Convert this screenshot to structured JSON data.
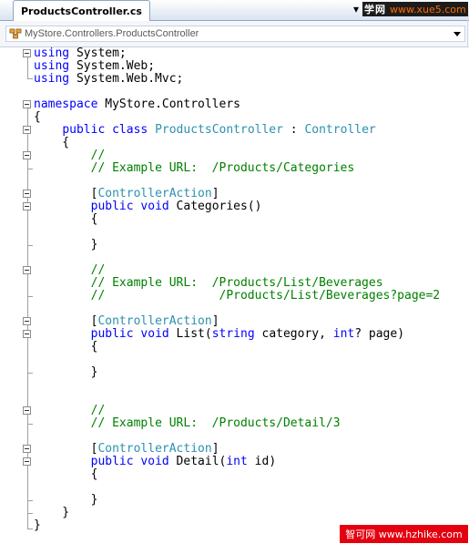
{
  "tab": {
    "title": "ProductsController.cs",
    "close_glyph": "▾"
  },
  "watermark_top": {
    "cn": "学网",
    "url": "www.xue5.com"
  },
  "navbar": {
    "class_path": "MyStore.Controllers.ProductsController"
  },
  "code_lines": [
    [
      {
        "t": "using",
        "c": "kw"
      },
      {
        "t": " System;"
      }
    ],
    [
      {
        "t": "using",
        "c": "kw"
      },
      {
        "t": " System.Web;"
      }
    ],
    [
      {
        "t": "using",
        "c": "kw"
      },
      {
        "t": " System.Web.Mvc;"
      }
    ],
    [],
    [
      {
        "t": "namespace",
        "c": "kw"
      },
      {
        "t": " MyStore.Controllers"
      }
    ],
    [
      {
        "t": "{"
      }
    ],
    [
      {
        "t": "    "
      },
      {
        "t": "public",
        "c": "kw"
      },
      {
        "t": " "
      },
      {
        "t": "class",
        "c": "kw"
      },
      {
        "t": " "
      },
      {
        "t": "ProductsController",
        "c": "ty"
      },
      {
        "t": " : "
      },
      {
        "t": "Controller",
        "c": "ty"
      }
    ],
    [
      {
        "t": "    {"
      }
    ],
    [
      {
        "t": "        "
      },
      {
        "t": "//",
        "c": "cm"
      }
    ],
    [
      {
        "t": "        "
      },
      {
        "t": "// Example URL:  /Products/Categories",
        "c": "cm"
      }
    ],
    [],
    [
      {
        "t": "        ["
      },
      {
        "t": "ControllerAction",
        "c": "ty"
      },
      {
        "t": "]"
      }
    ],
    [
      {
        "t": "        "
      },
      {
        "t": "public",
        "c": "kw"
      },
      {
        "t": " "
      },
      {
        "t": "void",
        "c": "kw"
      },
      {
        "t": " Categories()"
      }
    ],
    [
      {
        "t": "        {"
      }
    ],
    [],
    [
      {
        "t": "        }"
      }
    ],
    [],
    [
      {
        "t": "        "
      },
      {
        "t": "//",
        "c": "cm"
      }
    ],
    [
      {
        "t": "        "
      },
      {
        "t": "// Example URL:  /Products/List/Beverages",
        "c": "cm"
      }
    ],
    [
      {
        "t": "        "
      },
      {
        "t": "//                /Products/List/Beverages?page=2",
        "c": "cm"
      }
    ],
    [],
    [
      {
        "t": "        ["
      },
      {
        "t": "ControllerAction",
        "c": "ty"
      },
      {
        "t": "]"
      }
    ],
    [
      {
        "t": "        "
      },
      {
        "t": "public",
        "c": "kw"
      },
      {
        "t": " "
      },
      {
        "t": "void",
        "c": "kw"
      },
      {
        "t": " List("
      },
      {
        "t": "string",
        "c": "kw"
      },
      {
        "t": " category, "
      },
      {
        "t": "int",
        "c": "kw"
      },
      {
        "t": "? page)"
      }
    ],
    [
      {
        "t": "        {"
      }
    ],
    [],
    [
      {
        "t": "        }"
      }
    ],
    [],
    [],
    [
      {
        "t": "        "
      },
      {
        "t": "//",
        "c": "cm"
      }
    ],
    [
      {
        "t": "        "
      },
      {
        "t": "// Example URL:  /Products/Detail/3",
        "c": "cm"
      }
    ],
    [],
    [
      {
        "t": "        ["
      },
      {
        "t": "ControllerAction",
        "c": "ty"
      },
      {
        "t": "]"
      }
    ],
    [
      {
        "t": "        "
      },
      {
        "t": "public",
        "c": "kw"
      },
      {
        "t": " "
      },
      {
        "t": "void",
        "c": "kw"
      },
      {
        "t": " Detail("
      },
      {
        "t": "int",
        "c": "kw"
      },
      {
        "t": " id)"
      }
    ],
    [
      {
        "t": "        {"
      }
    ],
    [],
    [
      {
        "t": "        }"
      }
    ],
    [
      {
        "t": "    }"
      }
    ],
    [
      {
        "t": "}"
      }
    ]
  ],
  "watermark_bottom": {
    "text": "智可网 www.hzhike.com"
  },
  "colors": {
    "keyword": "#0000ff",
    "type": "#2b91af",
    "comment": "#008000",
    "watermark_red": "#e4000f"
  }
}
